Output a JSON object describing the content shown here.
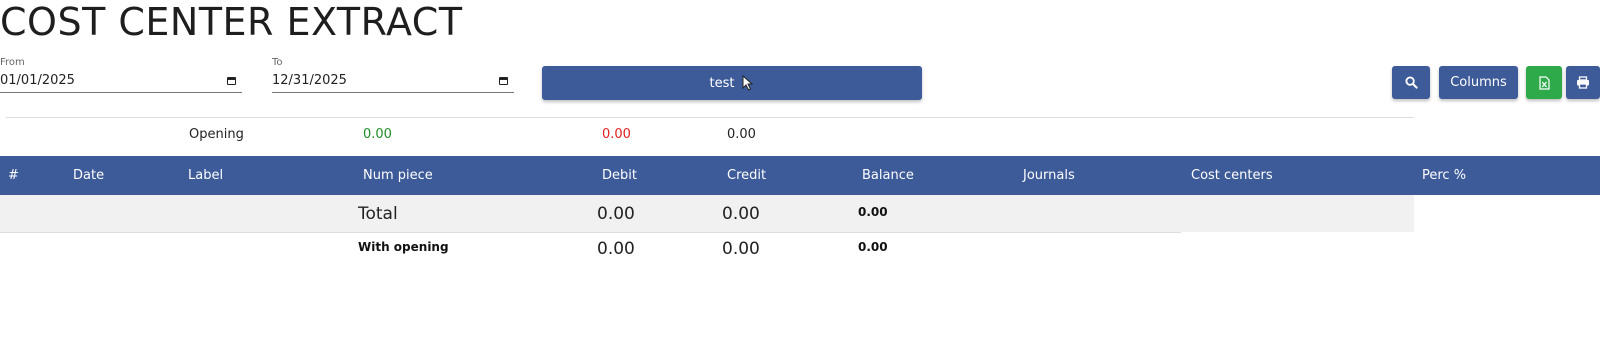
{
  "title": "COST CENTER EXTRACT",
  "filters": {
    "from_label": "From",
    "from_value": "01/01/2025",
    "to_label": "To",
    "to_value": "12/31/2025"
  },
  "toolbar": {
    "test_label": "test",
    "columns_label": "Columns",
    "search_icon": "search-icon",
    "excel_icon": "excel-icon",
    "print_icon": "print-icon"
  },
  "opening": {
    "label": "Opening",
    "debit": "0.00",
    "credit": "0.00",
    "balance": "0.00"
  },
  "table": {
    "columns": [
      "#",
      "Date",
      "Label",
      "Num piece",
      "Debit",
      "Credit",
      "Balance",
      "Journals",
      "Cost centers",
      "Perc %"
    ],
    "total": {
      "label": "Total",
      "debit": "0.00",
      "credit": "0.00",
      "balance": "0.00"
    },
    "with_opening": {
      "label": "With opening",
      "debit": "0.00",
      "credit": "0.00",
      "balance": "0.00"
    }
  },
  "colors": {
    "primary": "#3d5a99",
    "excel": "#2eaa4a",
    "debit_positive": "#1f8f2a",
    "credit_negative": "#e32020"
  }
}
